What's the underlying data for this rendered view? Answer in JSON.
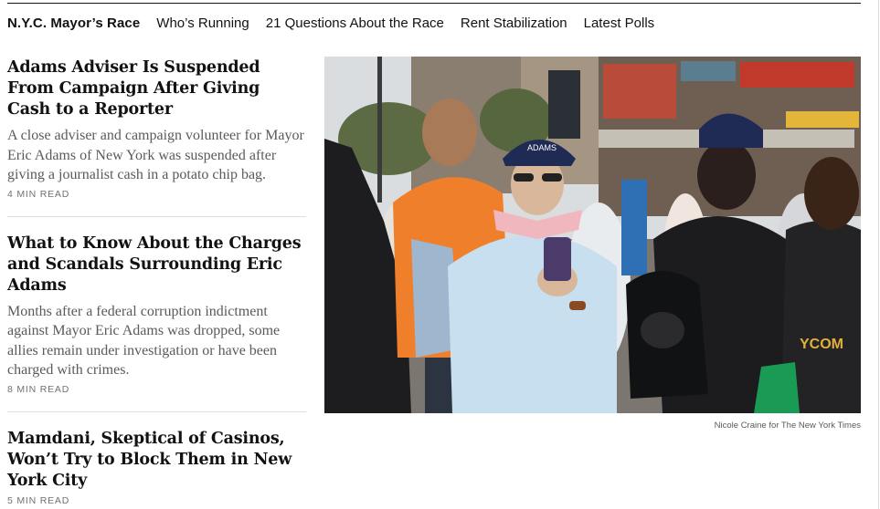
{
  "nav": {
    "section_title": "N.Y.C. Mayor’s Race",
    "links": [
      "Who’s Running",
      "21 Questions About the Race",
      "Rent Stabilization",
      "Latest Polls"
    ]
  },
  "stories": [
    {
      "headline": "Adams Adviser Is Suspended From Campaign After Giving Cash to a Reporter",
      "summary": "A close adviser and campaign volunteer for Mayor Eric Adams of New York was suspended after giving a journalist cash in a potato chip bag.",
      "read_time": "4 MIN READ"
    },
    {
      "headline": "What to Know About the Charges and Scandals Surrounding Eric Adams",
      "summary": "Months after a federal corruption indictment against Mayor Eric Adams was dropped, some allies remain under investigation or have been charged with crimes.",
      "read_time": "8 MIN READ"
    },
    {
      "headline": "Mamdani, Skeptical of Casinos, Won’t Try to Block Them in New York City",
      "read_time": "5 MIN READ"
    }
  ],
  "photo": {
    "credit": "Nicole Craine for The New York Times",
    "cap_text": "ADAMS",
    "shirt_text": "YCOM"
  },
  "colors": {
    "text": "#121212",
    "summary": "#5a5a5a",
    "meta": "#727272",
    "divider": "#dfdfdf",
    "orange_shirt": "#f07f2c",
    "navy_cap": "#1f2a55"
  }
}
